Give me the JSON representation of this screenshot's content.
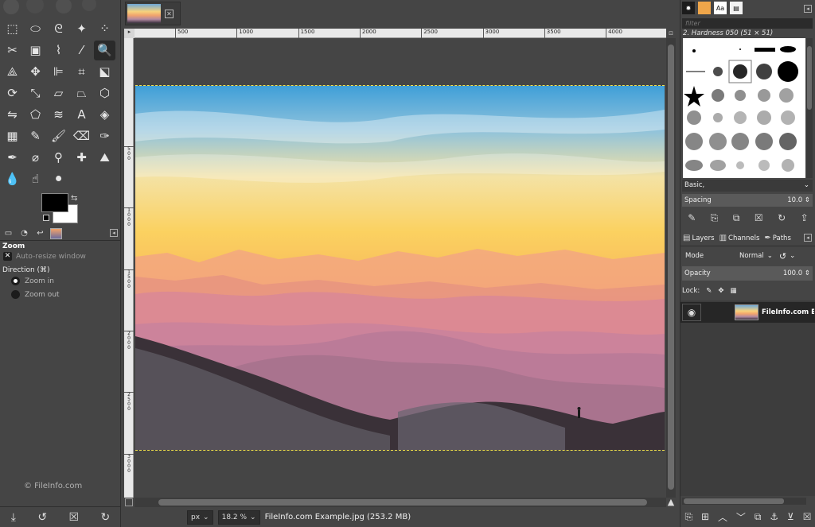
{
  "toolbox": {
    "tools": [
      {
        "icon": "rect-select-icon",
        "glyph": "⬚"
      },
      {
        "icon": "ellipse-select-icon",
        "glyph": "⬭"
      },
      {
        "icon": "free-select-icon",
        "glyph": "ᘓ"
      },
      {
        "icon": "fuzzy-select-icon",
        "glyph": "✦"
      },
      {
        "icon": "select-by-color-icon",
        "glyph": "⁘"
      },
      {
        "icon": "scissors-select-icon",
        "glyph": "✂"
      },
      {
        "icon": "foreground-select-icon",
        "glyph": "▣"
      },
      {
        "icon": "paths-tool-icon",
        "glyph": "⌇"
      },
      {
        "icon": "color-picker-icon",
        "glyph": "⁄"
      },
      {
        "icon": "zoom-tool-icon",
        "glyph": "🔍"
      },
      {
        "icon": "measure-tool-icon",
        "glyph": "⟁"
      },
      {
        "icon": "move-tool-icon",
        "glyph": "✥"
      },
      {
        "icon": "align-tool-icon",
        "glyph": "⊫"
      },
      {
        "icon": "crop-tool-icon",
        "glyph": "⌗"
      },
      {
        "icon": "unified-transform-icon",
        "glyph": "⬕"
      },
      {
        "icon": "rotate-tool-icon",
        "glyph": "⟳"
      },
      {
        "icon": "scale-tool-icon",
        "glyph": "⤡"
      },
      {
        "icon": "shear-tool-icon",
        "glyph": "▱"
      },
      {
        "icon": "perspective-tool-icon",
        "glyph": "⏢"
      },
      {
        "icon": "3d-transform-icon",
        "glyph": "⬡"
      },
      {
        "icon": "flip-tool-icon",
        "glyph": "⇋"
      },
      {
        "icon": "cage-transform-icon",
        "glyph": "⬠"
      },
      {
        "icon": "warp-transform-icon",
        "glyph": "≋"
      },
      {
        "icon": "text-tool-icon",
        "glyph": "A"
      },
      {
        "icon": "bucket-fill-icon",
        "glyph": "◈"
      },
      {
        "icon": "gradient-tool-icon",
        "glyph": "▦"
      },
      {
        "icon": "pencil-tool-icon",
        "glyph": "✎"
      },
      {
        "icon": "paintbrush-tool-icon",
        "glyph": "🖌"
      },
      {
        "icon": "eraser-tool-icon",
        "glyph": "⌫"
      },
      {
        "icon": "airbrush-tool-icon",
        "glyph": "✑"
      },
      {
        "icon": "ink-tool-icon",
        "glyph": "✒"
      },
      {
        "icon": "mypaint-brush-icon",
        "glyph": "⌀"
      },
      {
        "icon": "clone-tool-icon",
        "glyph": "⚲"
      },
      {
        "icon": "heal-tool-icon",
        "glyph": "✚"
      },
      {
        "icon": "perspective-clone-icon",
        "glyph": "⛰"
      },
      {
        "icon": "blur-sharpen-icon",
        "glyph": "💧"
      },
      {
        "icon": "smudge-tool-icon",
        "glyph": "☝"
      },
      {
        "icon": "dodge-burn-icon",
        "glyph": "⚫"
      }
    ],
    "options": {
      "title": "Zoom",
      "auto_resize": "Auto-resize window",
      "direction_label": "Direction  (⌘)",
      "zoom_in": "Zoom in",
      "zoom_out": "Zoom out"
    },
    "watermark": "© FileInfo.com",
    "colors": {
      "foreground": "#000000",
      "background": "#ffffff"
    }
  },
  "image_window": {
    "ruler_labels": [
      "500",
      "1000",
      "1500",
      "2000",
      "2500",
      "3000",
      "3500",
      "4000"
    ],
    "vruler_labels": [
      "5\n0\n0",
      "1\n0\n0\n0",
      "1\n5\n0\n0",
      "2\n0\n0\n0",
      "2\n5\n0\n0",
      "3\n0\n0\n0"
    ],
    "status": {
      "unit": "px",
      "zoom": "18.2 %",
      "file": "FileInfo.com Example.jpg (253.2 MB)"
    }
  },
  "dock": {
    "brush_filter_placeholder": "filter",
    "brush_name": "2. Hardness 050 (51 × 51)",
    "brush_preset": "Basic,",
    "spacing_label": "Spacing",
    "spacing_value": "10.0",
    "tabs": {
      "layers": "Layers",
      "channels": "Channels",
      "paths": "Paths"
    },
    "mode_label": "Mode",
    "mode_value": "Normal",
    "opacity_label": "Opacity",
    "opacity_value": "100.0",
    "lock_label": "Lock:",
    "layer_name": "FileInfo.com Example.jpg"
  }
}
